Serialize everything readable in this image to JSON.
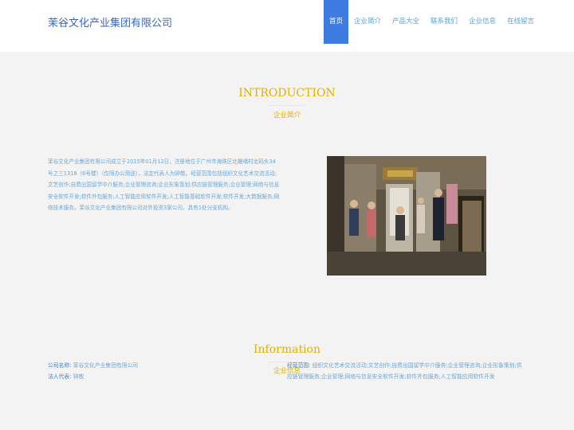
{
  "header": {
    "logo": "茉谷文化产业集团有限公司",
    "nav": [
      "首页",
      "企业简介",
      "产品大全",
      "联系我们",
      "企业信息",
      "在线留言"
    ]
  },
  "intro": {
    "title": "INTRODUCTION",
    "subtitle": "企业简介",
    "text": "茉谷文化产业集团有限公司成立于2015年01月12日，注册地位于广州市海珠区北栅埔村北码头34号之三1318（6号楼）（仅限办公用途），法定代表人为钟敬。经营范围包括组织文化艺术交流活动;文艺创作;自费出国留学中介服务;企业管理咨询;企业形象策划;供应链管理服务;企业管理;网络与信息安全软件开发;软件外包服务;人工智能应用软件开发;人工智能基础软件开发;软件开发;大数据服务;网络技术服务。茉谷文化产业集团有限公司对外投资3家公司，具有1处分支机构。"
  },
  "info": {
    "title": "Information",
    "subtitle": "企业信息",
    "company_label": "公司名称:",
    "company_value": "茉谷文化产业集团有限公司",
    "legal_label": "法人代表:",
    "legal_value": "钟敬",
    "scope_label": "经营范围:",
    "scope_value": "组织文化艺术交流活动;文艺创作;自费出国留学中介服务;企业管理咨询;企业形象策划;供应链管理服务;企业管理;网络与信息安全软件开发;软件外包服务;人工智能应用软件开发"
  }
}
